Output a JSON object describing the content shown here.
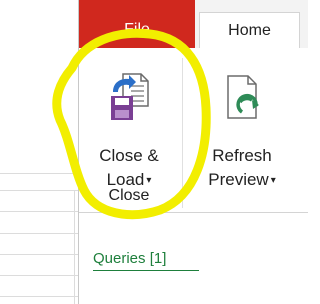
{
  "ribbon": {
    "tabs": [
      {
        "label": "File"
      },
      {
        "label": "Home"
      }
    ],
    "commands": {
      "close_load": {
        "line1": "Close &",
        "line2": "Load",
        "icon": "close-load-icon"
      },
      "refresh_preview": {
        "line1": "Refresh",
        "line2": "Preview",
        "icon": "refresh-preview-icon"
      },
      "dropdown_arrow": "▾"
    },
    "groups": {
      "close_label": "Close"
    }
  },
  "queries_pane": {
    "title": "Queries [1]"
  },
  "colors": {
    "file_tab": "#d0281e",
    "annotation": "#f2ee00",
    "queries_text": "#1e7f3c"
  }
}
